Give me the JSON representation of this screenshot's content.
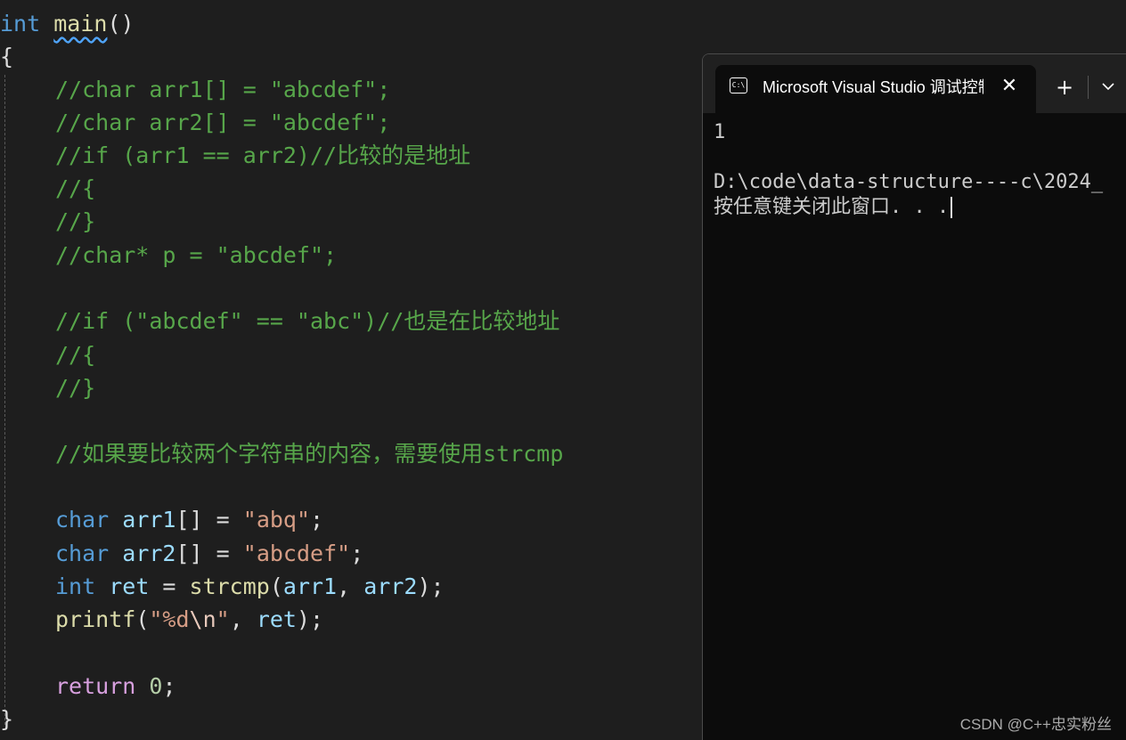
{
  "editor": {
    "lines": {
      "l1_kw": "int",
      "l1_fn": "main",
      "l1_paren": "()",
      "l2": "{",
      "l3": "//char arr1[] = \"abcdef\";",
      "l4": "//char arr2[] = \"abcdef\";",
      "l5": "//if (arr1 == arr2)//比较的是地址",
      "l6": "//{",
      "l7": "//}",
      "l8": "//char* p = \"abcdef\";",
      "l10": "//if (\"abcdef\" == \"abc\")//也是在比较地址",
      "l11": "//{",
      "l12": "//}",
      "l14": "//如果要比较两个字符串的内容，需要使用strcmp",
      "l16_kw": "char",
      "l16_var": "arr1",
      "l16_mid": "[] = ",
      "l16_str": "\"abq\"",
      "l16_end": ";",
      "l17_kw": "char",
      "l17_var": "arr2",
      "l17_mid": "[] = ",
      "l17_str": "\"abcdef\"",
      "l17_end": ";",
      "l18_kw": "int",
      "l18_var": "ret",
      "l18_eq": " = ",
      "l18_fn": "strcmp",
      "l18_open": "(",
      "l18_a1": "arr1",
      "l18_comma": ", ",
      "l18_a2": "arr2",
      "l18_close": ");",
      "l19_fn": "printf",
      "l19_open": "(",
      "l19_str1": "\"%d",
      "l19_esc": "\\n",
      "l19_str2": "\"",
      "l19_comma": ", ",
      "l19_var": "ret",
      "l19_close": ");",
      "l21_kw": "return",
      "l21_num": "0",
      "l21_end": ";",
      "l22": "}"
    }
  },
  "terminal": {
    "tab_title": "Microsoft Visual Studio 调试控制台",
    "icon_text": "C:\\",
    "close_glyph": "✕",
    "new_tab_glyph": "+",
    "output": [
      "1",
      "",
      "D:\\code\\data-structure----c\\2024_",
      "按任意键关闭此窗口. . ."
    ]
  },
  "watermark": "CSDN @C++忠实粉丝",
  "colors": {
    "editor_bg": "#1e1e1e",
    "comment": "#57a64a",
    "keyword": "#569cd6",
    "string": "#d69d85",
    "terminal_bg": "#0c0c0c"
  }
}
